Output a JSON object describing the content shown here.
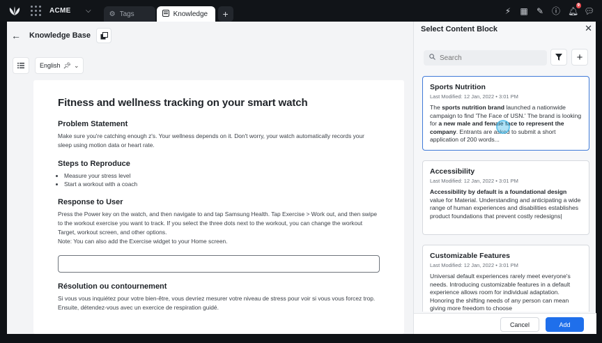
{
  "topbar": {
    "org_name": "ACME",
    "tabs": [
      {
        "label": "Tags",
        "icon": "gear-icon",
        "active": false
      },
      {
        "label": "Knowledge B",
        "icon": "kb-icon",
        "active": true
      }
    ],
    "notification_count": "9",
    "icons": [
      "bolt-icon",
      "calendar-icon",
      "pen-icon",
      "help-icon",
      "bell-icon",
      "chat-icon"
    ]
  },
  "header": {
    "title": "Knowledge Base"
  },
  "toolbar": {
    "language": "English"
  },
  "document": {
    "title": "Fitness and wellness tracking on your smart watch",
    "sections": [
      {
        "heading": "Problem Statement",
        "text": "Make sure you're catching enough z's. Your wellness depends on it. Don't worry, your watch automatically records your sleep using motion data or heart rate."
      },
      {
        "heading": "Steps to Reproduce",
        "items": [
          "Measure your stress level",
          "Start a workout with a coach"
        ]
      },
      {
        "heading": "Response to User",
        "text": "Press the Power key on the watch, and then navigate to and tap Samsung Health. Tap Exercise > Work out, and then swipe to the workout exercise you want to track. If you select the three dots next to the workout, you can change the workout Target, workout screen, and other options.",
        "note": "Note: You can also add the Exercise widget to your Home screen."
      },
      {
        "heading": "Résolution ou contournement",
        "text": "Si vous vous inquiétez pour votre bien-être, vous devriez mesurer votre niveau de stress pour voir si vous vous forcez trop. Ensuite, détendez-vous avec un exercice de respiration guidé."
      }
    ]
  },
  "panel": {
    "title": "Select Content Block",
    "search_placeholder": "Search",
    "cards": [
      {
        "title": "Sports Nutrition",
        "meta": "Last Modified: 12 Jan, 2022 • 3:01 PM",
        "selected": true,
        "body_parts": [
          "The ",
          "sports nutrition brand",
          " launched a nationwide campaign to find 'The Face of USN.' The brand is looking for ",
          "a new male and female face to represent the company",
          ". Entrants are asked to submit a short application of 200 words..."
        ]
      },
      {
        "title": "Accessibility",
        "meta": "Last Modified: 12 Jan, 2022 • 3:01 PM",
        "selected": false,
        "body_parts": [
          "Accessibility by default is a foundational design",
          " value for Material. Understanding and anticipating a wide range of human experiences and disabilities establishes product foundations that prevent costly redesigns|"
        ]
      },
      {
        "title": "Customizable Features",
        "meta": "Last Modified: 12 Jan, 2022 • 3:01 PM",
        "selected": false,
        "body": "Universal default experiences rarely meet everyone's needs. Introducing customizable features in a default experience allows room for individual adaptation. Honoring the shifting needs of any person can mean giving more freedom to choose"
      }
    ],
    "cancel_label": "Cancel",
    "add_label": "Add"
  }
}
